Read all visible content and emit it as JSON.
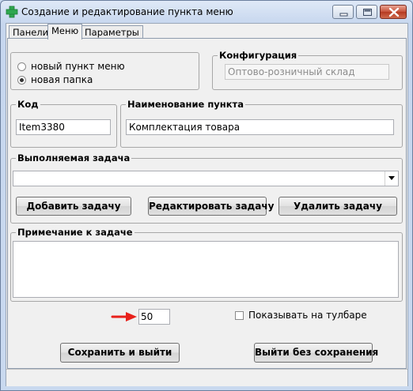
{
  "window": {
    "title": "Создание и редактирование пункта меню"
  },
  "tabs": [
    {
      "label": "Панели",
      "active": false
    },
    {
      "label": "Меню",
      "active": true
    },
    {
      "label": "Параметры",
      "active": false
    }
  ],
  "item_type": {
    "options": [
      {
        "label": "новый пункт меню",
        "selected": false
      },
      {
        "label": "новая папка",
        "selected": true
      }
    ]
  },
  "configuration": {
    "label": "Конфигурация",
    "value": "Оптово-розничный склад"
  },
  "code": {
    "label": "Код",
    "value": "Item3380"
  },
  "item_name": {
    "label": "Наименование пункта",
    "value": "Комплектация товара"
  },
  "task": {
    "label": "Выполняемая задача",
    "selected_value": "",
    "add_button": "Добавить задачу",
    "edit_button": "Редактировать задачу",
    "delete_button": "Удалить задачу"
  },
  "note": {
    "label": "Примечание к задаче",
    "value": ""
  },
  "order_number": "50",
  "show_on_toolbar": {
    "label": "Показывать на тулбаре",
    "checked": false
  },
  "footer": {
    "save_button": "Сохранить и выйти",
    "exit_button": "Выйти без сохранения"
  },
  "colors": {
    "arrow_indicator": "#e8211b",
    "app_icon": "#2fa84f"
  },
  "icons": {
    "app": "green-plus-icon",
    "minimize": "minimize-icon",
    "maximize": "maximize-icon",
    "close": "close-icon",
    "dropdown": "chevron-down-icon",
    "pointer": "red-arrow-icon"
  }
}
